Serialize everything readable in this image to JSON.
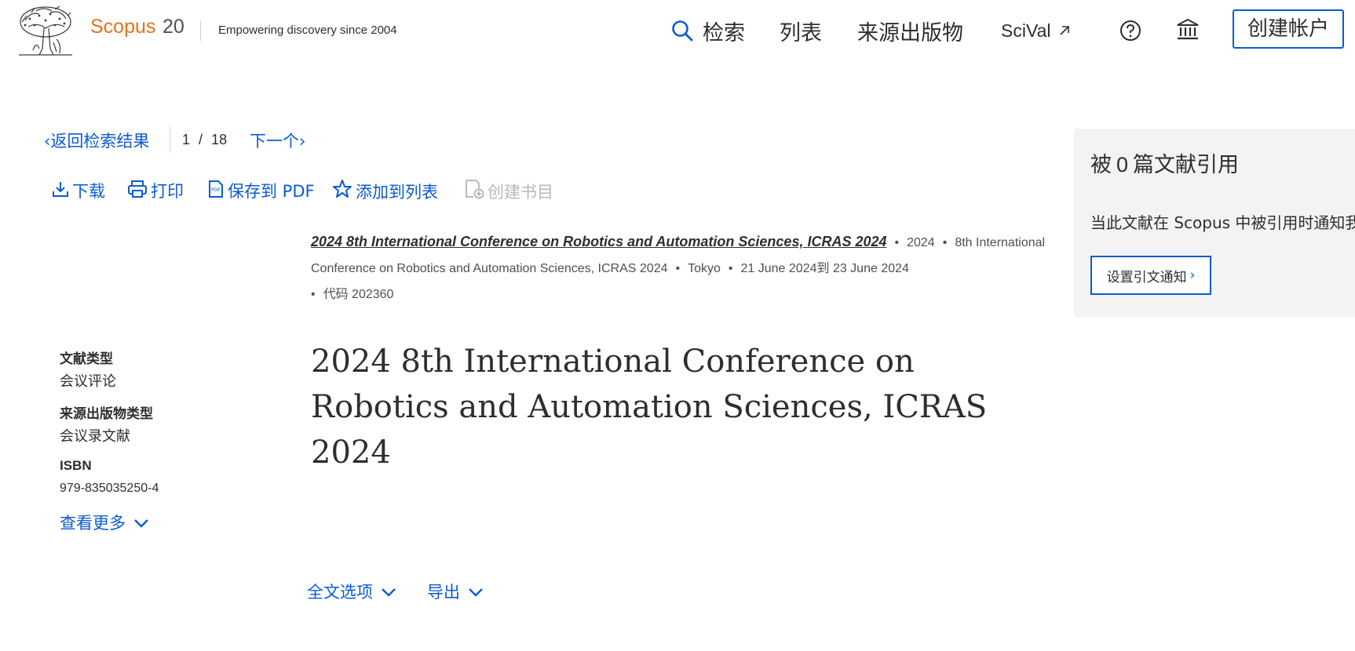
{
  "header": {
    "brand_name": "Scopus",
    "brand_anniversary": "20",
    "tagline": "Empowering discovery since 2004",
    "nav": {
      "search": "检索",
      "lists": "列表",
      "sources": "来源出版物",
      "scival": "SciVal"
    },
    "create_account": "创建帐户",
    "icons": [
      "elsevier-tree-logo",
      "search-icon",
      "external-link-icon",
      "help-icon",
      "institution-icon"
    ]
  },
  "result_nav": {
    "back_label": "返回检索结果",
    "current": "1",
    "separator": "/",
    "total": "18",
    "next_label": "下一个"
  },
  "toolbar": {
    "download": "下载",
    "print": "打印",
    "save_pdf": "保存到 PDF",
    "add_to_list": "添加到列表",
    "create_bibliography": "创建书目"
  },
  "source": {
    "title": "2024 8th International Conference on Robotics and Automation Sciences, ICRAS 2024",
    "year": "2024",
    "conference": "8th International Conference on Robotics and Automation Sciences, ICRAS 2024",
    "location": "Tokyo",
    "dates": "21 June 2024到 23 June 2024",
    "code": "代码 202360"
  },
  "metadata": {
    "doc_type_label": "文献类型",
    "doc_type_value": "会议评论",
    "source_type_label": "来源出版物类型",
    "source_type_value": "会议录文献",
    "isbn_label": "ISBN",
    "isbn_value": "979-835035250-4",
    "show_more": "查看更多"
  },
  "document": {
    "title": "2024 8th International Conference on Robotics and Automation Sciences, ICRAS 2024"
  },
  "actions": {
    "fulltext_options": "全文选项",
    "export": "导出"
  },
  "citations": {
    "prefix": "被",
    "count": "0",
    "suffix": "篇文献引用",
    "alert_text": "当此文献在 Scopus 中被引用时通知我：",
    "set_alert": "设置引文通知"
  },
  "colors": {
    "brand": "#e9711c",
    "link": "#0a5bd3",
    "panel": "#f3f3f3"
  }
}
